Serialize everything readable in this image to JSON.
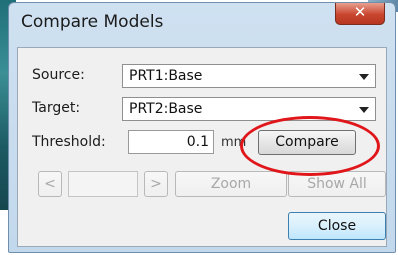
{
  "window": {
    "title": "Compare Models",
    "close_glyph": "✕"
  },
  "source": {
    "label": "Source:",
    "value": "PRT1:Base"
  },
  "target": {
    "label": "Target:",
    "value": "PRT2:Base"
  },
  "threshold": {
    "label": "Threshold:",
    "value": "0.1",
    "unit": "mm"
  },
  "buttons": {
    "compare": "Compare",
    "prev": "<",
    "next": ">",
    "zoom": "Zoom",
    "show_all": "Show All",
    "close": "Close"
  },
  "colors": {
    "highlight": "#e0161b",
    "title_bar": "#c2d8ec",
    "close_button": "#c9452e"
  }
}
